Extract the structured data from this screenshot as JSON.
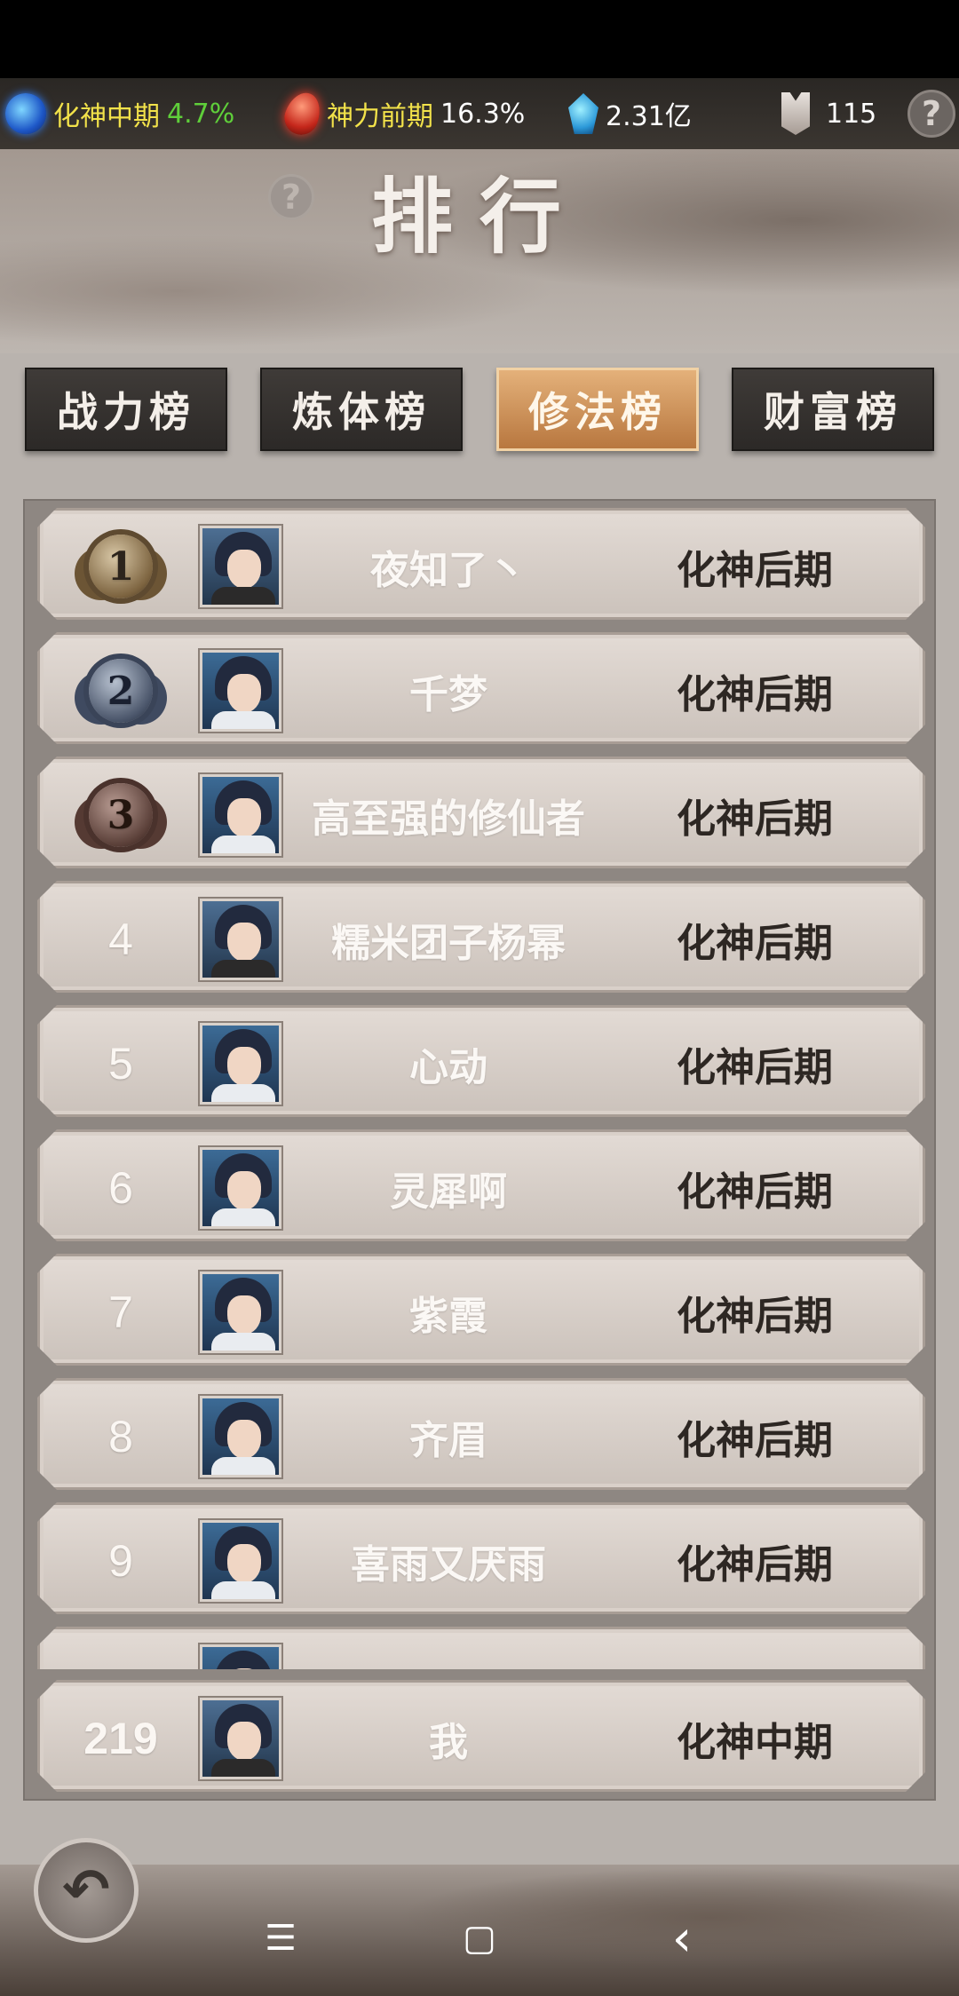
{
  "resources": {
    "realm_label": "化神中期",
    "realm_progress": "4.7%",
    "body_label": "神力前期",
    "body_progress": "16.3%",
    "spirit_stones": "2.31亿",
    "tokens": "115",
    "help": "?"
  },
  "header": {
    "title": "排行",
    "help": "?"
  },
  "tabs": [
    {
      "label": "战力榜",
      "active": false
    },
    {
      "label": "炼体榜",
      "active": false
    },
    {
      "label": "修法榜",
      "active": true
    },
    {
      "label": "财富榜",
      "active": false
    }
  ],
  "rankings": [
    {
      "rank": "1",
      "name": "夜知了丶",
      "realm": "化神后期"
    },
    {
      "rank": "2",
      "name": "千梦",
      "realm": "化神后期"
    },
    {
      "rank": "3",
      "name": "高至强的修仙者",
      "realm": "化神后期"
    },
    {
      "rank": "4",
      "name": "糯米团子杨幂",
      "realm": "化神后期"
    },
    {
      "rank": "5",
      "name": "心动",
      "realm": "化神后期"
    },
    {
      "rank": "6",
      "name": "灵犀啊",
      "realm": "化神后期"
    },
    {
      "rank": "7",
      "name": "紫霞",
      "realm": "化神后期"
    },
    {
      "rank": "8",
      "name": "齐眉",
      "realm": "化神后期"
    },
    {
      "rank": "9",
      "name": "喜雨又厌雨",
      "realm": "化神后期"
    }
  ],
  "my_rank": {
    "rank": "219",
    "name": "我",
    "realm": "化神中期"
  },
  "nav": {
    "menu": "☰",
    "home": "▢",
    "back": "‹"
  }
}
